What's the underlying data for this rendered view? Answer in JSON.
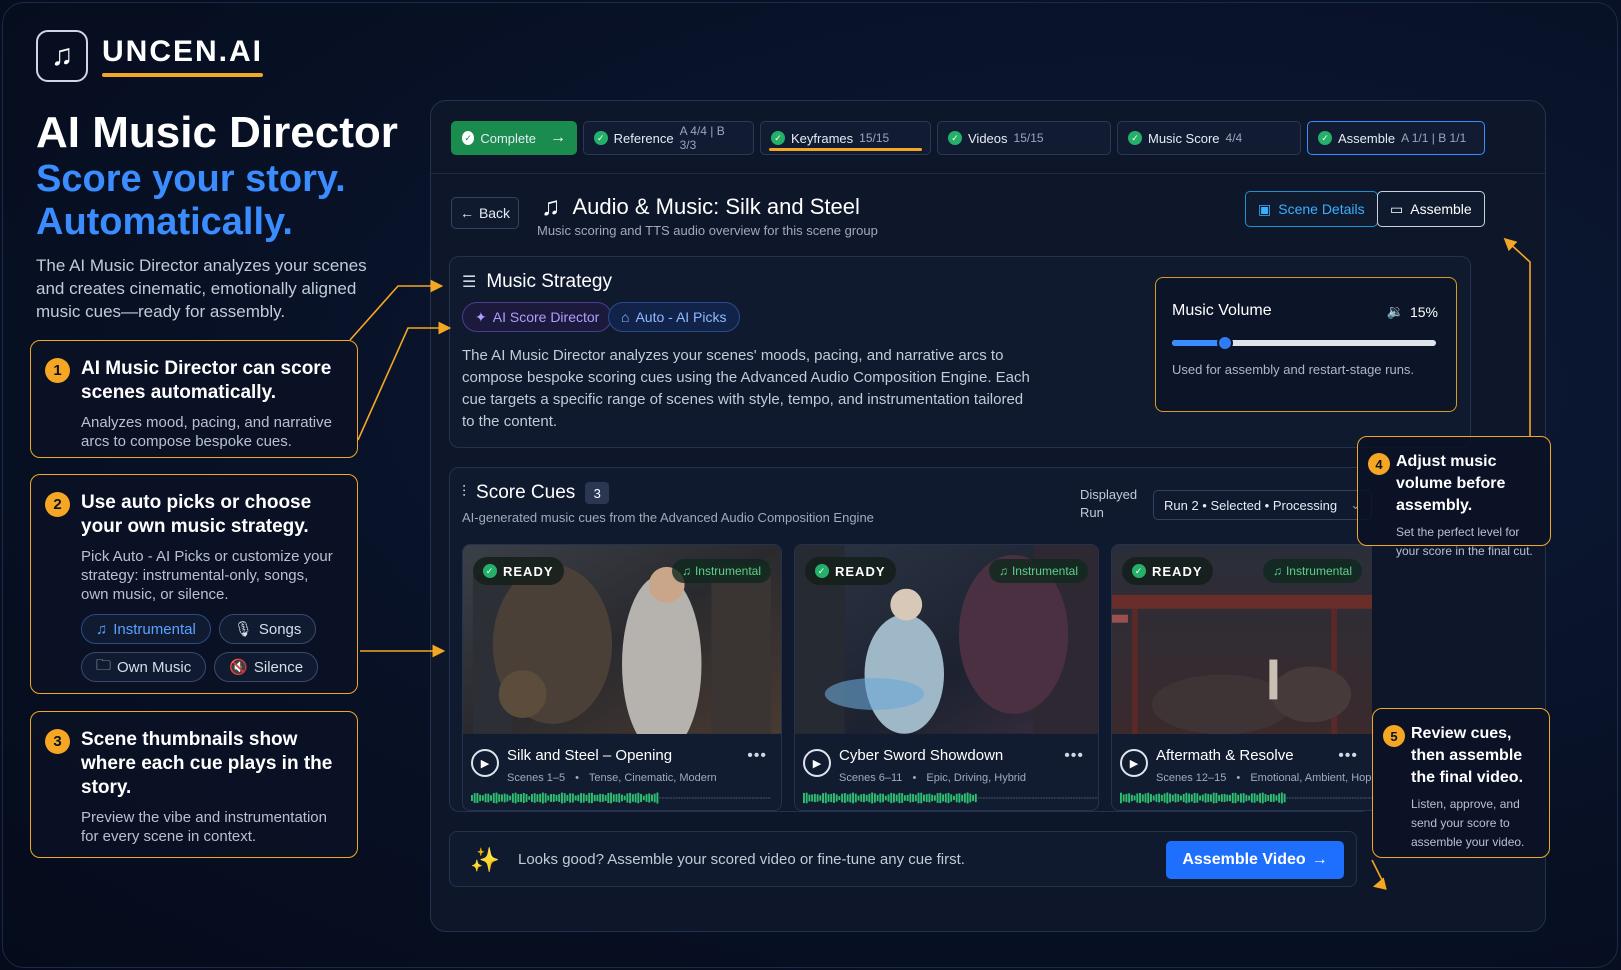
{
  "brand": {
    "name": "UNCEN.AI",
    "logo_icon": "music-note-icon"
  },
  "headline": {
    "line1": "AI Music Director",
    "line2": "Score your story.",
    "line3": "Automatically."
  },
  "intro": "The AI Music Director analyzes your scenes and creates cinematic, emotionally aligned music cues—ready for assembly.",
  "callouts": [
    {
      "num": "1",
      "title": "AI Music Director can score scenes automatically.",
      "desc": "Analyzes mood, pacing, and narrative arcs to compose bespoke cues."
    },
    {
      "num": "2",
      "title": "Use auto picks or choose your own music strategy.",
      "desc": "Pick Auto - AI Picks or customize your strategy: instrumental-only, songs, own music, or silence.",
      "chips": [
        "Instrumental",
        "Songs",
        "Own Music",
        "Silence"
      ]
    },
    {
      "num": "3",
      "title": "Scene thumbnails show where each cue plays in the story.",
      "desc": "Preview the vibe and instrumentation for every scene in context."
    },
    {
      "num": "4",
      "title": "Adjust music volume before assembly.",
      "desc": "Set the perfect level for your score in the final cut."
    },
    {
      "num": "5",
      "title": "Review cues, then assemble the final video.",
      "desc": "Listen, approve, and send your score to assemble your video."
    }
  ],
  "steps": [
    {
      "label": "Complete",
      "meta": ""
    },
    {
      "label": "Reference",
      "meta": "A 4/4 | B 3/3"
    },
    {
      "label": "Keyframes",
      "meta": "15/15"
    },
    {
      "label": "Videos",
      "meta": "15/15"
    },
    {
      "label": "Music Score",
      "meta": "4/4"
    },
    {
      "label": "Assemble",
      "meta": "A 1/1 | B 1/1"
    }
  ],
  "header": {
    "back_label": "Back",
    "title": "Audio & Music: Silk and Steel",
    "subtitle": "Music scoring and TTS audio overview for this scene group",
    "scene_details_label": "Scene Details",
    "assemble_label": "Assemble"
  },
  "strategy": {
    "title": "Music Strategy",
    "pill_ai": "AI Score Director",
    "pill_auto": "Auto - AI Picks",
    "description": "The AI Music Director analyzes your scenes' moods, pacing, and narrative arcs to compose bespoke scoring cues using the Advanced Audio Composition Engine. Each cue targets a specific range of scenes with style, tempo, and instrumentation tailored to the content."
  },
  "volume": {
    "title": "Music Volume",
    "percent_label": "15%",
    "level": 0.2,
    "note": "Used for assembly and restart-stage runs."
  },
  "cues": {
    "title": "Score Cues",
    "count": "3",
    "subtitle": "AI-generated music cues from the Advanced Audio Composition Engine",
    "displayed_run_label": "Displayed Run",
    "run_value": "Run 2 • Selected • Processing",
    "items": [
      {
        "status": "READY",
        "tag": "Instrumental",
        "title": "Silk and Steel – Opening",
        "scenes": "Scenes 1–5",
        "mood": "Tense, Cinematic, Modern",
        "progress": 0.62
      },
      {
        "status": "READY",
        "tag": "Instrumental",
        "title": "Cyber Sword Showdown",
        "scenes": "Scenes 6–11",
        "mood": "Epic, Driving, Hybrid",
        "progress": 0.58
      },
      {
        "status": "READY",
        "tag": "Instrumental",
        "title": "Aftermath & Resolve",
        "scenes": "Scenes 12–15",
        "mood": "Emotional, Ambient, Hopeful",
        "progress": 0.55
      }
    ]
  },
  "footer": {
    "message": "Looks good? Assemble your scored video or fine-tune any cue first.",
    "button": "Assemble Video"
  },
  "colors": {
    "accent": "#f5a623",
    "primary": "#1f6fff",
    "success": "#25b06a",
    "background": "#081126"
  }
}
